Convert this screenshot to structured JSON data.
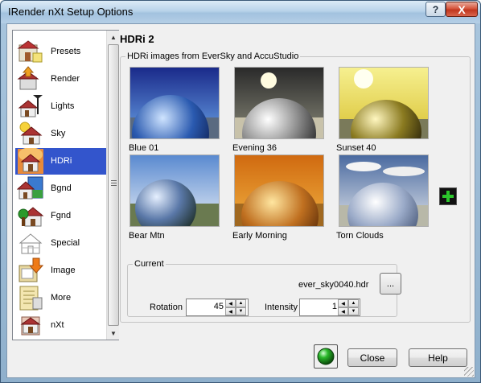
{
  "window": {
    "title": "IRender nXt Setup Options",
    "help_glyph": "?",
    "close_glyph": "X"
  },
  "sidebar": {
    "items": [
      {
        "label": "Presets",
        "icon": "presets-icon"
      },
      {
        "label": "Render",
        "icon": "render-icon"
      },
      {
        "label": "Lights",
        "icon": "lights-icon"
      },
      {
        "label": "Sky",
        "icon": "sky-icon"
      },
      {
        "label": "HDRi",
        "icon": "hdri-icon",
        "selected": true
      },
      {
        "label": "Bgnd",
        "icon": "background-icon"
      },
      {
        "label": "Fgnd",
        "icon": "foreground-icon"
      },
      {
        "label": "Special",
        "icon": "special-icon"
      },
      {
        "label": "Image",
        "icon": "image-icon"
      },
      {
        "label": "More",
        "icon": "more-icon"
      },
      {
        "label": "nXt",
        "icon": "nxt-icon"
      }
    ]
  },
  "panel": {
    "title": "HDRi 2",
    "group_label": "HDRi images from EverSky and AccuStudio",
    "thumbnails": [
      {
        "label": "Blue 01"
      },
      {
        "label": "Evening 36"
      },
      {
        "label": "Sunset 40"
      },
      {
        "label": "Bear Mtn"
      },
      {
        "label": "Early Morning"
      },
      {
        "label": "Torn Clouds"
      }
    ],
    "current": {
      "label": "Current",
      "filename": "ever_sky0040.hdr",
      "browse_label": "...",
      "rotation_label": "Rotation",
      "rotation_value": "45",
      "intensity_label": "Intensity",
      "intensity_value": "1"
    }
  },
  "footer": {
    "close_label": "Close",
    "help_label": "Help"
  },
  "colors": {
    "selection": "#3355cc",
    "add_button_plus": "#22aa22"
  }
}
